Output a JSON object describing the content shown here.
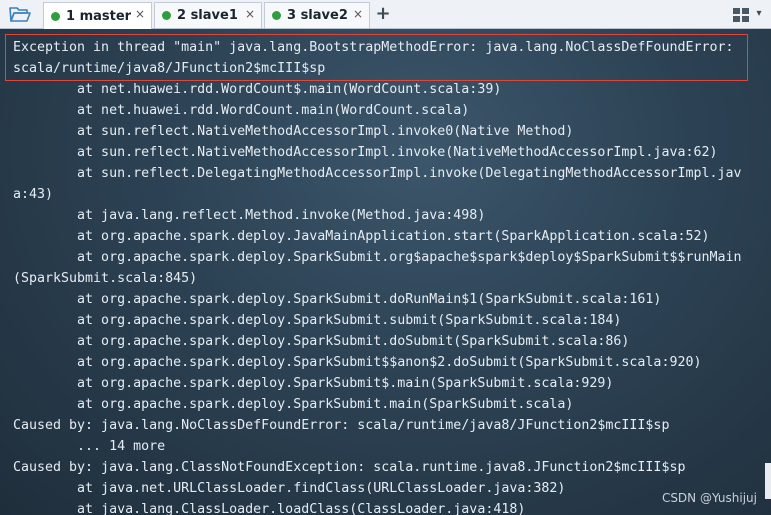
{
  "tabs": [
    {
      "label": "1 master",
      "dot_color": "#2e9e3e",
      "active": true
    },
    {
      "label": "2 slave1",
      "dot_color": "#2e9e3e",
      "active": false
    },
    {
      "label": "3 slave2",
      "dot_color": "#2e9e3e",
      "active": false
    }
  ],
  "icons": {
    "folder": "folder-open-icon",
    "close": "×",
    "add": "+",
    "layout": "grid-layout-icon",
    "menu": "▾"
  },
  "terminal": {
    "lines": [
      "Exception in thread \"main\" java.lang.BootstrapMethodError: java.lang.NoClassDefFoundError:",
      "scala/runtime/java8/JFunction2$mcIII$sp",
      "        at net.huawei.rdd.WordCount$.main(WordCount.scala:39)",
      "        at net.huawei.rdd.WordCount.main(WordCount.scala)",
      "        at sun.reflect.NativeMethodAccessorImpl.invoke0(Native Method)",
      "        at sun.reflect.NativeMethodAccessorImpl.invoke(NativeMethodAccessorImpl.java:62)",
      "        at sun.reflect.DelegatingMethodAccessorImpl.invoke(DelegatingMethodAccessorImpl.jav",
      "a:43)",
      "        at java.lang.reflect.Method.invoke(Method.java:498)",
      "        at org.apache.spark.deploy.JavaMainApplication.start(SparkApplication.scala:52)",
      "        at org.apache.spark.deploy.SparkSubmit.org$apache$spark$deploy$SparkSubmit$$runMain",
      "(SparkSubmit.scala:845)",
      "        at org.apache.spark.deploy.SparkSubmit.doRunMain$1(SparkSubmit.scala:161)",
      "        at org.apache.spark.deploy.SparkSubmit.submit(SparkSubmit.scala:184)",
      "        at org.apache.spark.deploy.SparkSubmit.doSubmit(SparkSubmit.scala:86)",
      "        at org.apache.spark.deploy.SparkSubmit$$anon$2.doSubmit(SparkSubmit.scala:920)",
      "        at org.apache.spark.deploy.SparkSubmit$.main(SparkSubmit.scala:929)",
      "        at org.apache.spark.deploy.SparkSubmit.main(SparkSubmit.scala)",
      "Caused by: java.lang.NoClassDefFoundError: scala/runtime/java8/JFunction2$mcIII$sp",
      "        ... 14 more",
      "Caused by: java.lang.ClassNotFoundException: scala.runtime.java8.JFunction2$mcIII$sp",
      "        at java.net.URLClassLoader.findClass(URLClassLoader.java:382)",
      "        at java.lang.ClassLoader.loadClass(ClassLoader.java:418)"
    ],
    "highlight_color": "#e0453a",
    "text_color": "#e6ecf2"
  },
  "watermark": "CSDN @Yushijuj"
}
